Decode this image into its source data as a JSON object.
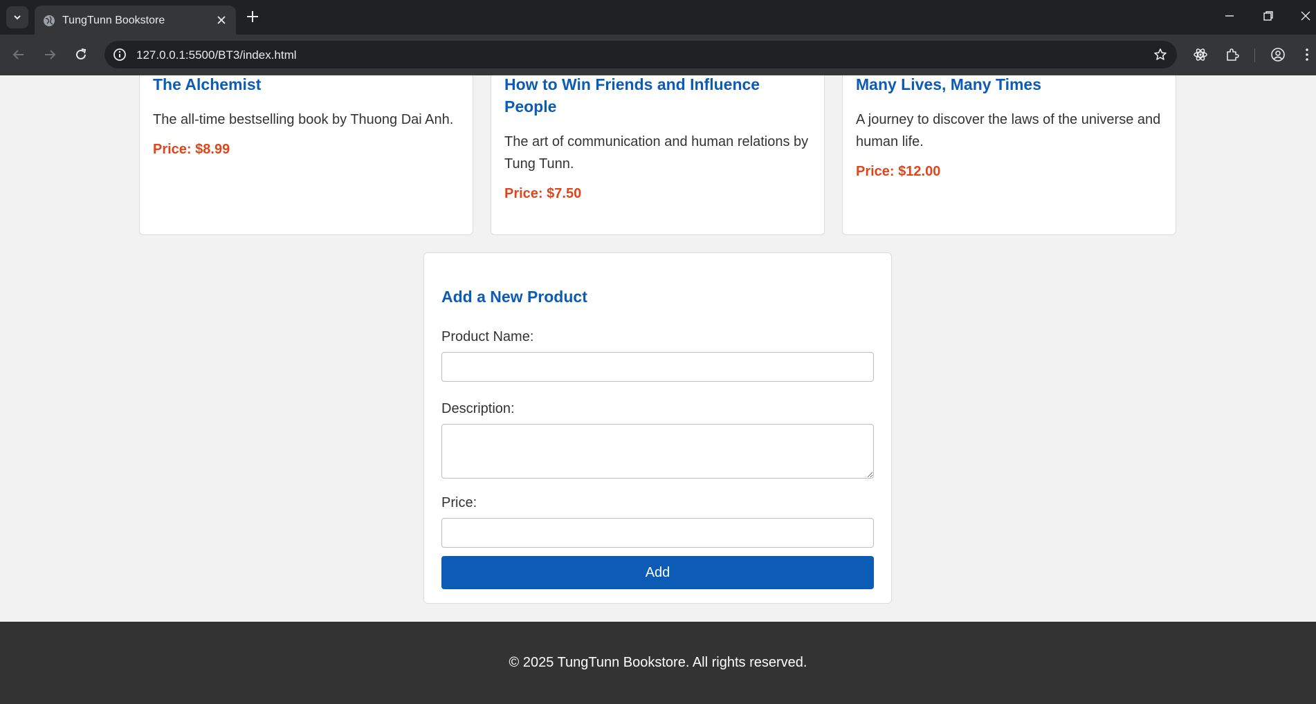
{
  "browser": {
    "tab_title": "TungTunn Bookstore",
    "url": "127.0.0.1:5500/BT3/index.html"
  },
  "products": [
    {
      "title": "The Alchemist",
      "description": "The all-time bestselling book by Thuong Dai Anh.",
      "price": "Price: $8.99"
    },
    {
      "title": "How to Win Friends and Influence People",
      "description": "The art of communication and human relations by Tung Tunn.",
      "price": "Price: $7.50"
    },
    {
      "title": "Many Lives, Many Times",
      "description": "A journey to discover the laws of the universe and human life.",
      "price": "Price: $12.00"
    }
  ],
  "form": {
    "title": "Add a New Product",
    "name_label": "Product Name:",
    "name_value": "",
    "description_label": "Description:",
    "description_value": "",
    "price_label": "Price:",
    "price_value": "",
    "submit_label": "Add"
  },
  "footer": {
    "text": "© 2025 TungTunn Bookstore. All rights reserved."
  },
  "colors": {
    "accent_blue": "#0c5bb5",
    "price_red": "#e0451b",
    "footer_bg": "#333333"
  }
}
